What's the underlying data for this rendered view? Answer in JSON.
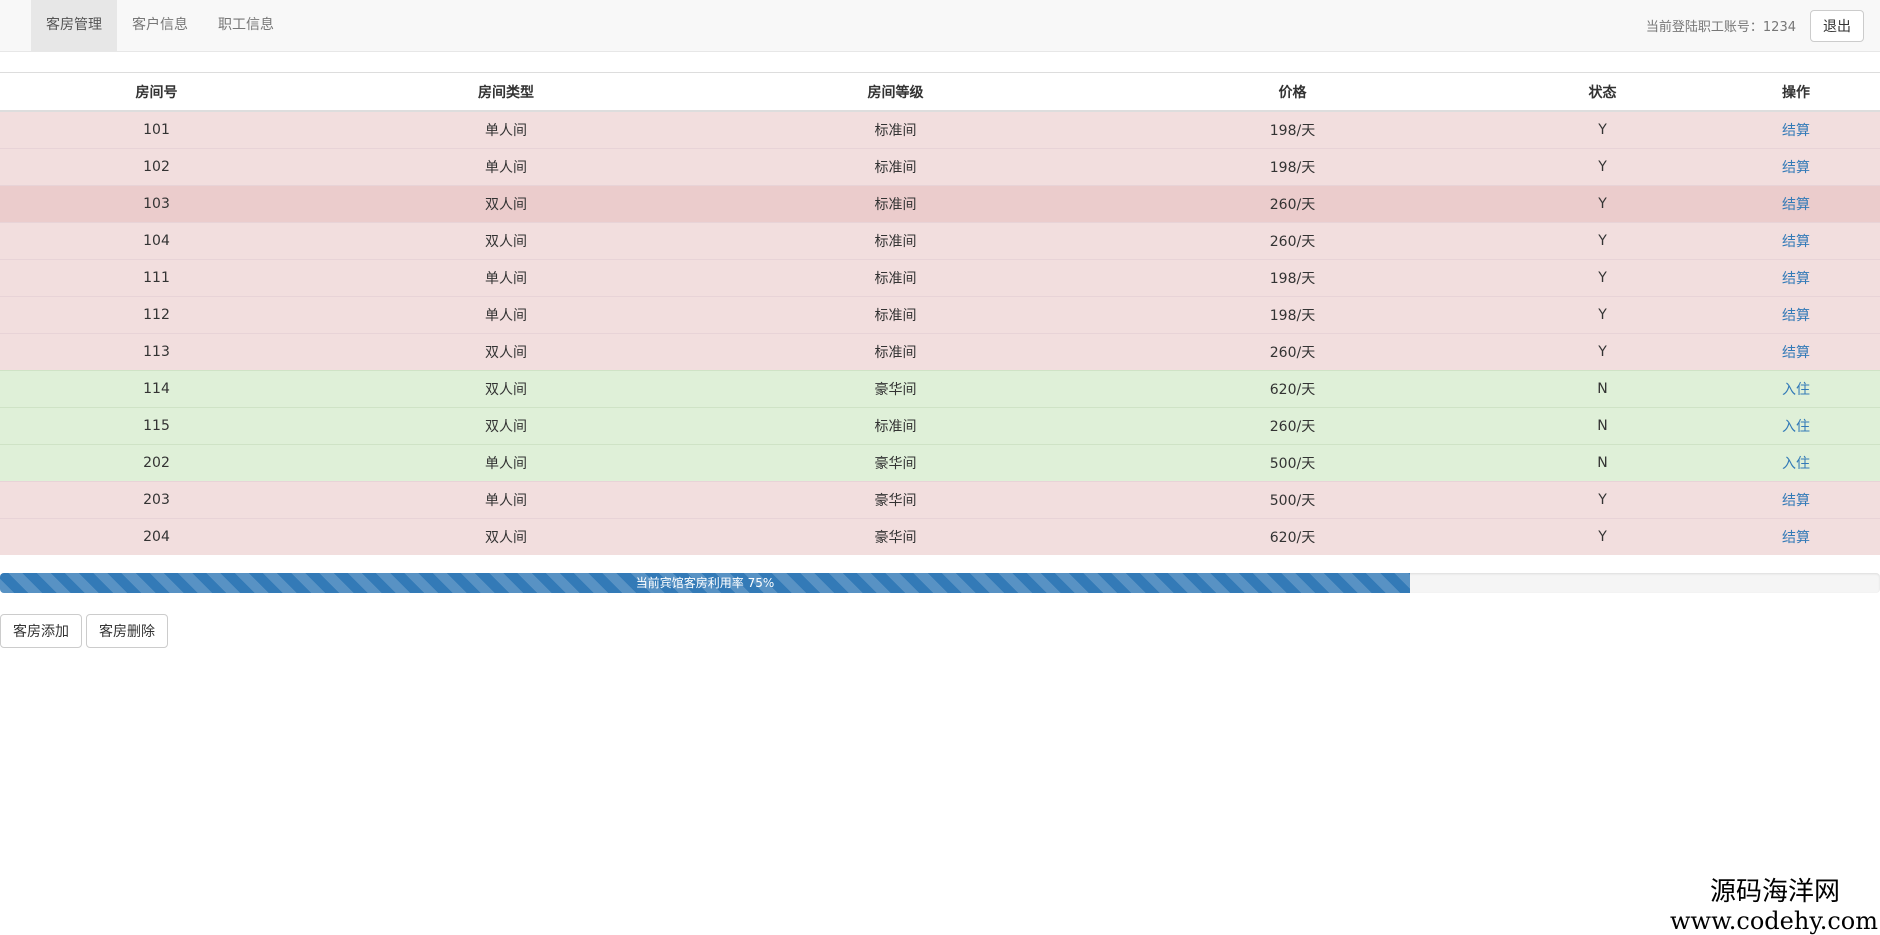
{
  "nav": {
    "tabs": [
      {
        "label": "客房管理",
        "active": true
      },
      {
        "label": "客户信息",
        "active": false
      },
      {
        "label": "职工信息",
        "active": false
      }
    ],
    "login_label": "当前登陆职工账号：",
    "account": "1234",
    "logout_label": "退出"
  },
  "table": {
    "headers": [
      "房间号",
      "房间类型",
      "房间等级",
      "价格",
      "状态",
      "操作"
    ],
    "rows": [
      {
        "room": "101",
        "type": "单人间",
        "grade": "标准间",
        "price": "198/天",
        "status": "Y",
        "action": "结算"
      },
      {
        "room": "102",
        "type": "单人间",
        "grade": "标准间",
        "price": "198/天",
        "status": "Y",
        "action": "结算"
      },
      {
        "room": "103",
        "type": "双人间",
        "grade": "标准间",
        "price": "260/天",
        "status": "Y",
        "action": "结算"
      },
      {
        "room": "104",
        "type": "双人间",
        "grade": "标准间",
        "price": "260/天",
        "status": "Y",
        "action": "结算"
      },
      {
        "room": "111",
        "type": "单人间",
        "grade": "标准间",
        "price": "198/天",
        "status": "Y",
        "action": "结算"
      },
      {
        "room": "112",
        "type": "单人间",
        "grade": "标准间",
        "price": "198/天",
        "status": "Y",
        "action": "结算"
      },
      {
        "room": "113",
        "type": "双人间",
        "grade": "标准间",
        "price": "260/天",
        "status": "Y",
        "action": "结算"
      },
      {
        "room": "114",
        "type": "双人间",
        "grade": "豪华间",
        "price": "620/天",
        "status": "N",
        "action": "入住"
      },
      {
        "room": "115",
        "type": "双人间",
        "grade": "标准间",
        "price": "260/天",
        "status": "N",
        "action": "入住"
      },
      {
        "room": "202",
        "type": "单人间",
        "grade": "豪华间",
        "price": "500/天",
        "status": "N",
        "action": "入住"
      },
      {
        "room": "203",
        "type": "单人间",
        "grade": "豪华间",
        "price": "500/天",
        "status": "Y",
        "action": "结算"
      },
      {
        "room": "204",
        "type": "双人间",
        "grade": "豪华间",
        "price": "620/天",
        "status": "Y",
        "action": "结算"
      }
    ]
  },
  "progress": {
    "label": "当前宾馆客房利用率 75%",
    "value_percent": 75
  },
  "buttons": {
    "add_label": "客房添加",
    "delete_label": "客房删除"
  },
  "watermark": {
    "name": "源码海洋网",
    "url": "www.codehy.com"
  },
  "colors": {
    "occupied_row": "#f2dede",
    "vacant_row": "#dff0d8",
    "link": "#337ab7",
    "progress_bar": "#337ab7"
  }
}
